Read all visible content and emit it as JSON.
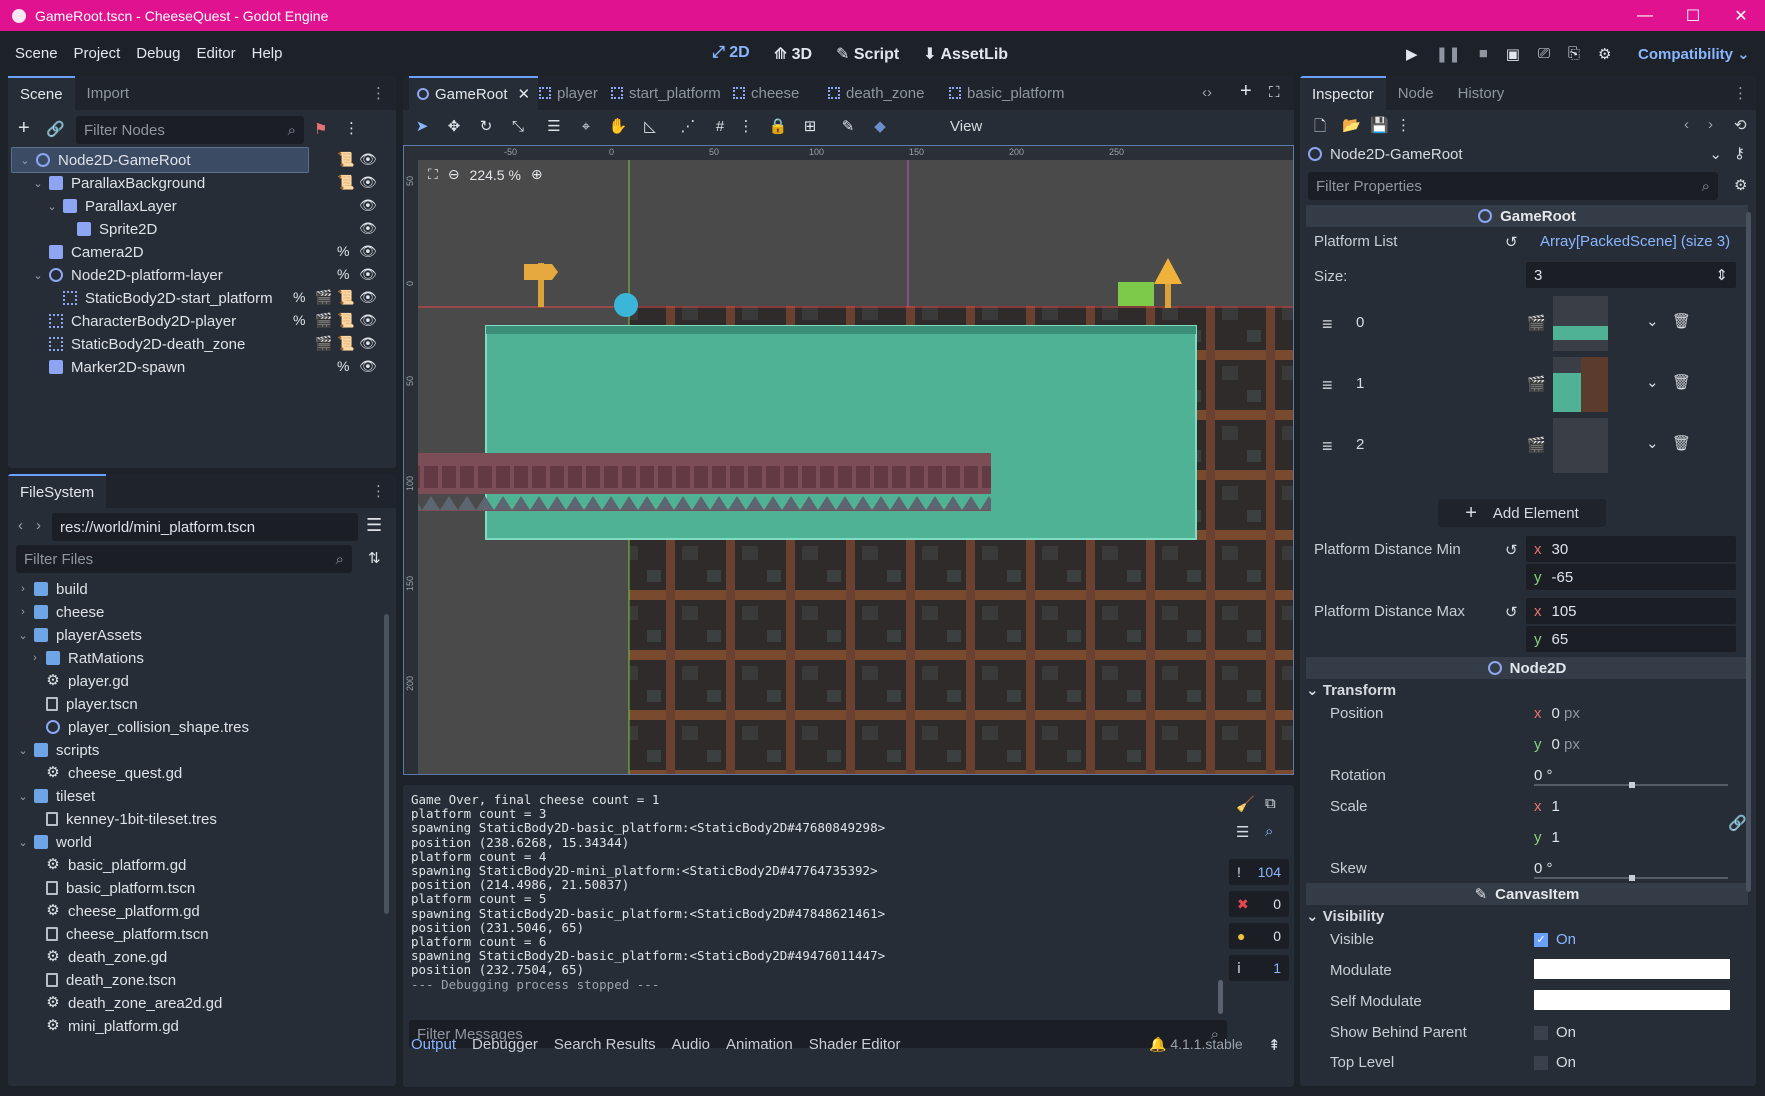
{
  "window": {
    "title": "GameRoot.tscn - CheeseQuest - Godot Engine"
  },
  "menu": [
    "Scene",
    "Project",
    "Debug",
    "Editor",
    "Help"
  ],
  "workspaces": [
    {
      "label": "2D",
      "active": true
    },
    {
      "label": "3D"
    },
    {
      "label": "Script"
    },
    {
      "label": "AssetLib"
    }
  ],
  "renderer": "Compatibility",
  "scene_dock": {
    "tabs": [
      "Scene",
      "Import"
    ],
    "filter_placeholder": "Filter Nodes",
    "nodes": [
      {
        "label": "Node2D-GameRoot",
        "icon": "node2d-icon",
        "depth": 0,
        "selected": true
      },
      {
        "label": "ParallaxBackground",
        "icon": "parallax-background-icon",
        "depth": 1
      },
      {
        "label": "ParallaxLayer",
        "icon": "parallax-layer-icon",
        "depth": 2
      },
      {
        "label": "Sprite2D",
        "icon": "sprite2d-icon",
        "depth": 3
      },
      {
        "label": "Camera2D",
        "icon": "camera2d-icon",
        "depth": 1
      },
      {
        "label": "Node2D-platform-layer",
        "icon": "node2d-icon",
        "depth": 1
      },
      {
        "label": "StaticBody2D-start_platform",
        "icon": "staticbody2d-icon",
        "depth": 2
      },
      {
        "label": "CharacterBody2D-player",
        "icon": "characterbody2d-icon",
        "depth": 1
      },
      {
        "label": "StaticBody2D-death_zone",
        "icon": "staticbody2d-icon",
        "depth": 1
      },
      {
        "label": "Marker2D-spawn",
        "icon": "marker2d-icon",
        "depth": 1
      }
    ]
  },
  "filesystem": {
    "tab": "FileSystem",
    "path": "res://world/mini_platform.tscn",
    "filter_placeholder": "Filter Files",
    "items": [
      {
        "label": "build",
        "type": "folder",
        "depth": 1,
        "arrow": "›"
      },
      {
        "label": "cheese",
        "type": "folder",
        "depth": 1,
        "arrow": "›"
      },
      {
        "label": "playerAssets",
        "type": "folder",
        "depth": 1,
        "arrow": "⌄"
      },
      {
        "label": "RatMations",
        "type": "folder",
        "depth": 2,
        "arrow": "›"
      },
      {
        "label": "player.gd",
        "type": "gear",
        "depth": 2
      },
      {
        "label": "player.tscn",
        "type": "file",
        "depth": 2
      },
      {
        "label": "player_collision_shape.tres",
        "type": "shape",
        "depth": 2
      },
      {
        "label": "scripts",
        "type": "folder",
        "depth": 1,
        "arrow": "⌄"
      },
      {
        "label": "cheese_quest.gd",
        "type": "gear",
        "depth": 2
      },
      {
        "label": "tileset",
        "type": "folder",
        "depth": 1,
        "arrow": "⌄"
      },
      {
        "label": "kenney-1bit-tileset.tres",
        "type": "file",
        "depth": 2
      },
      {
        "label": "world",
        "type": "folder",
        "depth": 1,
        "arrow": "⌄"
      },
      {
        "label": "basic_platform.gd",
        "type": "gear",
        "depth": 2
      },
      {
        "label": "basic_platform.tscn",
        "type": "file",
        "depth": 2
      },
      {
        "label": "cheese_platform.gd",
        "type": "gear",
        "depth": 2
      },
      {
        "label": "cheese_platform.tscn",
        "type": "file",
        "depth": 2
      },
      {
        "label": "death_zone.gd",
        "type": "gear",
        "depth": 2
      },
      {
        "label": "death_zone.tscn",
        "type": "file",
        "depth": 2
      },
      {
        "label": "death_zone_area2d.gd",
        "type": "gear",
        "depth": 2
      },
      {
        "label": "mini_platform.gd",
        "type": "gear",
        "depth": 2
      }
    ]
  },
  "editor_tabs": [
    "GameRoot",
    "player",
    "start_platform",
    "cheese",
    "death_zone",
    "basic_platform"
  ],
  "viewport": {
    "zoom": "224.5 %",
    "view_label": "View",
    "ruler_top": [
      "-50",
      "0",
      "50",
      "100",
      "150",
      "200",
      "250"
    ],
    "ruler_left": [
      "50",
      "0",
      "50",
      "100",
      "150",
      "200"
    ]
  },
  "output": {
    "lines": [
      "Game Over, final cheese count = 1",
      "platform count = 3",
      "spawning StaticBody2D-basic_platform:<StaticBody2D#47680849298>",
      "position (238.6268, 15.34344)",
      "platform count = 4",
      "spawning StaticBody2D-mini_platform:<StaticBody2D#47764735392>",
      "position (214.4986, 21.50837)",
      "platform count = 5",
      "spawning StaticBody2D-basic_platform:<StaticBody2D#47848621461>",
      "position (231.5046, 65)",
      "platform count = 6",
      "spawning StaticBody2D-basic_platform:<StaticBody2D#49476011447>",
      "position (232.7504, 65)",
      "--- Debugging process stopped ---"
    ],
    "filter_placeholder": "Filter Messages",
    "counts": {
      "messages": "104",
      "errors": "0",
      "warnings": "0",
      "info": "1"
    },
    "tabs": [
      "Output",
      "Debugger",
      "Search Results",
      "Audio",
      "Animation",
      "Shader Editor"
    ],
    "version": "4.1.1.stable"
  },
  "inspector": {
    "tabs": [
      "Inspector",
      "Node",
      "History"
    ],
    "object": "Node2D-GameRoot",
    "filter_placeholder": "Filter Properties",
    "section_gameroot": "GameRoot",
    "platform_list_label": "Platform List",
    "platform_list_value": "Array[PackedScene] (size 3)",
    "size_label": "Size:",
    "size_value": "3",
    "elements": [
      "0",
      "1",
      "2"
    ],
    "add_element": "Add Element",
    "dist_min_label": "Platform Distance Min",
    "dist_min_x": "30",
    "dist_min_y": "-65",
    "dist_max_label": "Platform Distance Max",
    "dist_max_x": "105",
    "dist_max_y": "65",
    "section_node2d": "Node2D",
    "transform": "Transform",
    "position_label": "Position",
    "pos_x": "0",
    "pos_y": "0",
    "px": "px",
    "rotation_label": "Rotation",
    "rotation": "0 °",
    "scale_label": "Scale",
    "scale_x": "1",
    "scale_y": "1",
    "skew_label": "Skew",
    "skew": "0 °",
    "section_canvas": "CanvasItem",
    "visibility": "Visibility",
    "visible_label": "Visible",
    "visible_on": "On",
    "modulate_label": "Modulate",
    "self_modulate_label": "Self Modulate",
    "behind_label": "Show Behind Parent",
    "behind_on": "On",
    "top_label": "Top Level",
    "top_on": "On",
    "x": "x",
    "y": "y"
  }
}
